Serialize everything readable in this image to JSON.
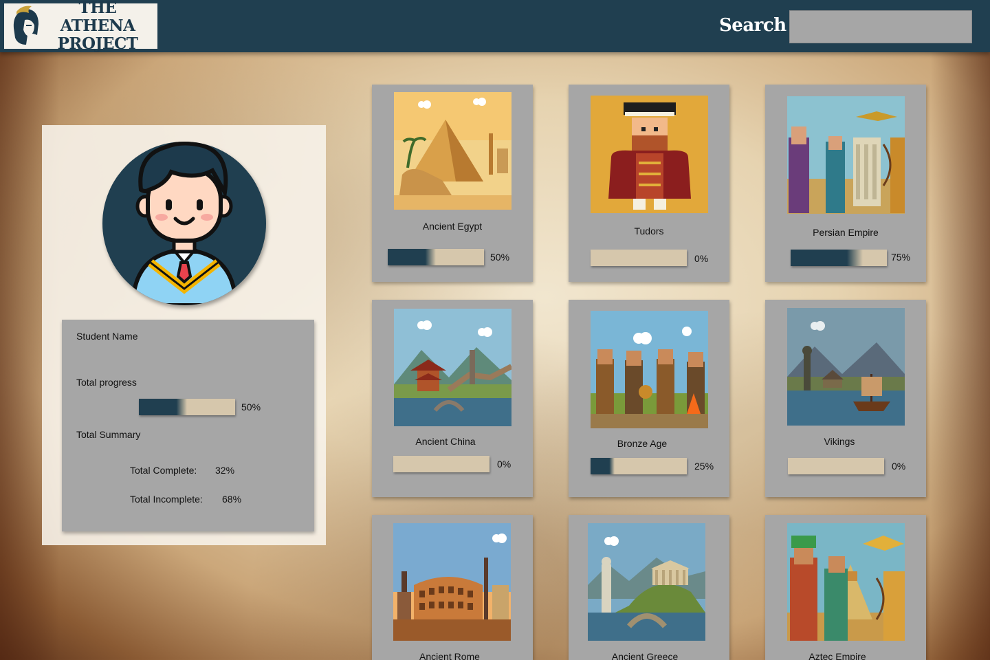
{
  "header": {
    "logo_line1": "THE ATHENA",
    "logo_line2": "PROJECT",
    "search_label": "Search",
    "search_value": ""
  },
  "profile": {
    "name_label": "Student Name",
    "progress_label": "Total progress",
    "progress": 0.5,
    "progress_text": "50%",
    "summary_label": "Total Summary",
    "complete_label": "Total Complete:",
    "complete_value": "32%",
    "incomplete_label": "Total Incomplete:",
    "incomplete_value": "68%"
  },
  "colors": {
    "header_bg": "#203f50",
    "bar_fill": "#203f50",
    "bar_track": "#d6c7ac",
    "card_bg": "#a6a6a6"
  },
  "topics": [
    {
      "title": "Ancient Egypt",
      "progress": 0.5,
      "progress_text": "50%",
      "scene": "egypt"
    },
    {
      "title": "Tudors",
      "progress": 0,
      "progress_text": "0%",
      "scene": "tudors"
    },
    {
      "title": "Persian Empire",
      "progress": 0.75,
      "progress_text": "75%",
      "scene": "persia"
    },
    {
      "title": "Ancient China",
      "progress": 0,
      "progress_text": "0%",
      "scene": "china"
    },
    {
      "title": "Bronze Age",
      "progress": 0.25,
      "progress_text": "25%",
      "scene": "bronze"
    },
    {
      "title": "Vikings",
      "progress": 0,
      "progress_text": "0%",
      "scene": "vikings"
    },
    {
      "title": "Ancient Rome",
      "scene": "rome"
    },
    {
      "title": "Ancient Greece",
      "scene": "greece"
    },
    {
      "title": "Aztec Empire",
      "scene": "aztec"
    }
  ]
}
